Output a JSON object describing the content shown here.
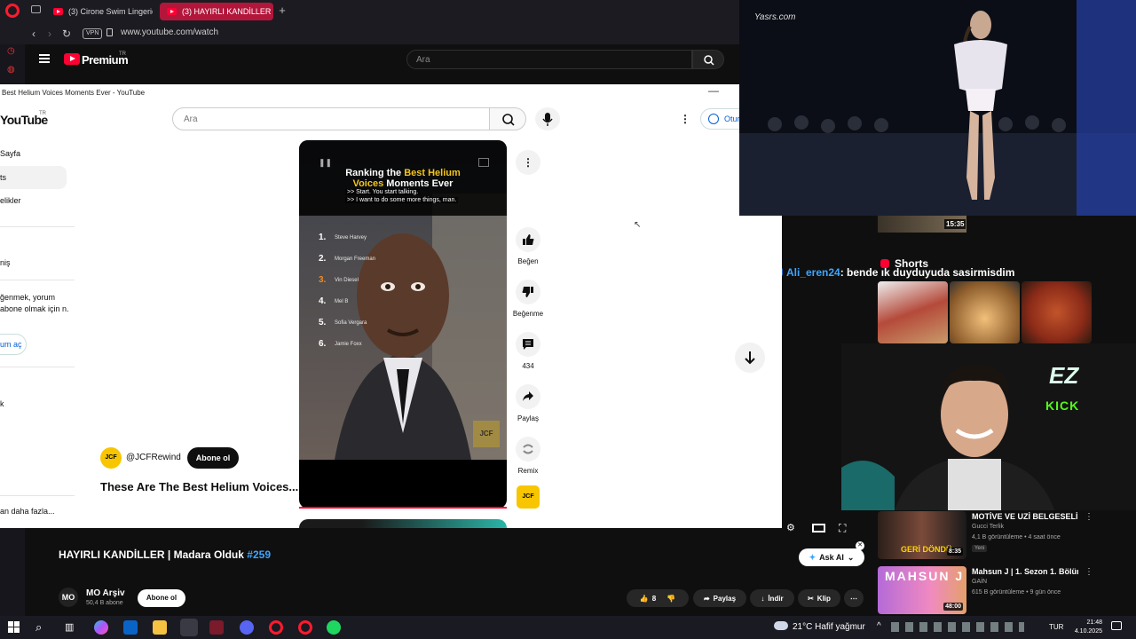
{
  "browser": {
    "tabs": [
      {
        "label": "(3) Cirone Swim Lingerie |"
      },
      {
        "label": "(3) HAYIRLI KANDİLLER |"
      }
    ],
    "vpn_label": "VPN",
    "url": "www.youtube.com/watch"
  },
  "bg_page": {
    "logo_text": "Premium",
    "logo_sup": "TR",
    "search_placeholder": "Ara",
    "video_title": "HAYIRLI KANDİLLER | Madara Olduk",
    "video_tag": "#259",
    "channel_avatar": "MO",
    "channel_name": "MO Arşiv",
    "channel_subs": "50,4 B abone",
    "subscribe": "Abone ol",
    "like_count": "8",
    "share": "Paylaş",
    "download": "İndir",
    "clip": "Klip",
    "ask_ai": "Ask AI",
    "recommendations": [
      {
        "title": "MOTİVE VE UZİ BELGESELİ",
        "channel": "Gucci Terlik",
        "meta": "4,1 B görüntüleme • 4 saat önce",
        "badge": "Yeni",
        "duration": "8:35",
        "thumb_text": "GERİ DÖNDÜ"
      },
      {
        "title": "Mahsun J | 1. Sezon 1. Bölüm",
        "channel": "GAİN",
        "meta": "615 B görüntüleme • 9 gün önce",
        "duration": "48:00",
        "thumb_text": "MAHSUN J"
      }
    ],
    "top_duration": "15:35",
    "shorts_label": "Shorts"
  },
  "chat": {
    "user": "Ali_eren24",
    "message": ": bende ık duyduyuda sasirmisdim"
  },
  "popup": {
    "window_title": "Best Helium Voices Moments Ever - YouTube",
    "logo": "YouTube",
    "logo_sup": "TR",
    "search_placeholder": "Ara",
    "sign_in": "Otur",
    "sidebar": {
      "items": [
        "Sayfa",
        "ts",
        "elikler",
        "niş",
        "k",
        "an daha fazla..."
      ],
      "note": "ğenmek, yorum abone olmak için n.",
      "sign_in": "um aç"
    },
    "short": {
      "title_line1_a": "Ranking the ",
      "title_line1_b": "Best Helium",
      "title_line2_a": "Voices",
      "title_line2_b": " Moments Ever",
      "sub1": ">> Start. You start talking.",
      "sub2": ">> I want to do some more things, man.",
      "ranking": [
        {
          "n": "1.",
          "name": "Steve Harvey"
        },
        {
          "n": "2.",
          "name": "Morgan Freeman"
        },
        {
          "n": "3.",
          "name": "Vin Diesel"
        },
        {
          "n": "4.",
          "name": "Mel B"
        },
        {
          "n": "5.",
          "name": "Sofia Vergara"
        },
        {
          "n": "6.",
          "name": "Jamie Foxx"
        }
      ],
      "corner_logo": "JCF",
      "channel": "@JCFRewind",
      "channel_avatar": "JCF",
      "subscribe": "Abone ol",
      "caption": "These Are The Best Helium Voices..."
    },
    "actions": {
      "like": "Beğen",
      "dislike": "Beğenme",
      "comments": "434",
      "share": "Paylaş",
      "remix": "Remix"
    }
  },
  "overlay": {
    "watermark": "Yasrs.com",
    "ez": "EZ",
    "kick": "KICK"
  },
  "taskbar": {
    "weather": "21°C  Hafif yağmur",
    "lang": "TUR",
    "time": "21:48",
    "date": "4.10.2025"
  },
  "colors": {
    "youtube_red": "#ff0033",
    "tab_active": "#b3163b",
    "link_blue": "#3ea6ff",
    "kick_green": "#53fc18"
  }
}
